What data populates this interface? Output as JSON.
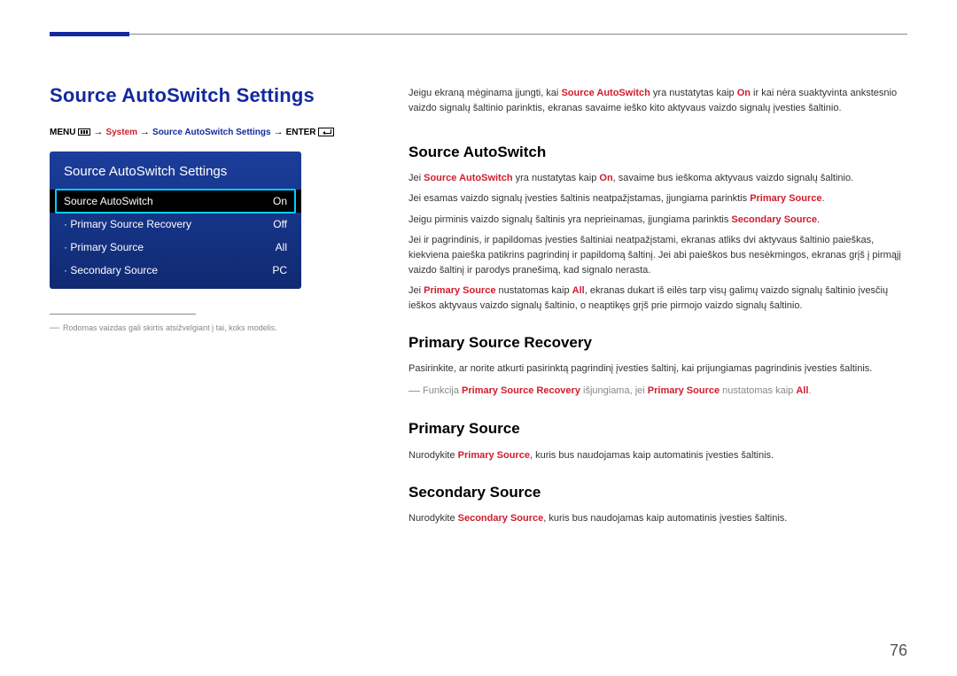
{
  "page_number": "76",
  "main_title": "Source AutoSwitch Settings",
  "breadcrumb": {
    "menu": "MENU",
    "system": "System",
    "path": "Source AutoSwitch Settings",
    "enter": "ENTER"
  },
  "osd": {
    "title": "Source AutoSwitch Settings",
    "rows": [
      {
        "label": "Source AutoSwitch",
        "value": "On",
        "selected": true,
        "bullet": false
      },
      {
        "label": "Primary Source Recovery",
        "value": "Off",
        "selected": false,
        "bullet": true
      },
      {
        "label": "Primary Source",
        "value": "All",
        "selected": false,
        "bullet": true
      },
      {
        "label": "Secondary Source",
        "value": "PC",
        "selected": false,
        "bullet": true
      }
    ]
  },
  "footnote": "Rodomas vaizdas gali skirtis atsižvelgiant į tai, koks modelis.",
  "right": {
    "intro_pre": "Jeigu ekraną mėginama įjungti, kai ",
    "intro_term1": "Source AutoSwitch",
    "intro_mid1": " yra nustatytas kaip ",
    "intro_term2": "On",
    "intro_mid2": " ir kai nėra suaktyvinta ankstesnio vaizdo signalų šaltinio parinktis, ekranas savaime ieško kito aktyvaus vaizdo signalų įvesties šaltinio.",
    "h_sas": "Source AutoSwitch",
    "sas_p1_pre": "Jei ",
    "sas_p1_t1": "Source AutoSwitch",
    "sas_p1_mid": " yra nustatytas kaip ",
    "sas_p1_t2": "On",
    "sas_p1_post": ", savaime bus ieškoma aktyvaus vaizdo signalų šaltinio.",
    "sas_p2_pre": "Jei esamas vaizdo signalų įvesties šaltinis neatpažįstamas, įjungiama parinktis ",
    "sas_p2_t": "Primary Source",
    "sas_p2_post": ".",
    "sas_p3_pre": "Jeigu pirminis vaizdo signalų šaltinis yra neprieinamas, įjungiama parinktis ",
    "sas_p3_t": "Secondary Source",
    "sas_p3_post": ".",
    "sas_p4": "Jei ir pagrindinis, ir papildomas įvesties šaltiniai neatpažįstami, ekranas atliks dvi aktyvaus šaltinio paieškas, kiekviena paieška patikrins pagrindinį ir papildomą šaltinį. Jei abi paieškos bus nesėkmingos, ekranas grįš į pirmąjį vaizdo šaltinį ir parodys pranešimą, kad signalo nerasta.",
    "sas_p5_pre": "Jei ",
    "sas_p5_t1": "Primary Source",
    "sas_p5_mid": " nustatomas kaip ",
    "sas_p5_t2": "All",
    "sas_p5_post": ", ekranas dukart iš eilės tarp visų galimų vaizdo signalų šaltinio įvesčių ieškos aktyvaus vaizdo signalų šaltinio, o neaptikęs grįš prie pirmojo vaizdo signalų šaltinio.",
    "h_psr": "Primary Source Recovery",
    "psr_p1": "Pasirinkite, ar norite atkurti pasirinktą pagrindinį įvesties šaltinį, kai prijungiamas pagrindinis įvesties šaltinis.",
    "psr_note_pre": "Funkcija ",
    "psr_note_t1": "Primary Source Recovery",
    "psr_note_mid": " išjungiama, jei ",
    "psr_note_t2": "Primary Source",
    "psr_note_mid2": " nustatomas kaip ",
    "psr_note_t3": "All",
    "psr_note_post": ".",
    "h_ps": "Primary Source",
    "ps_p_pre": "Nurodykite ",
    "ps_p_t": "Primary Source",
    "ps_p_post": ", kuris bus naudojamas kaip automatinis įvesties šaltinis.",
    "h_ss": "Secondary Source",
    "ss_p_pre": "Nurodykite ",
    "ss_p_t": "Secondary Source",
    "ss_p_post": ", kuris bus naudojamas kaip automatinis įvesties šaltinis."
  }
}
